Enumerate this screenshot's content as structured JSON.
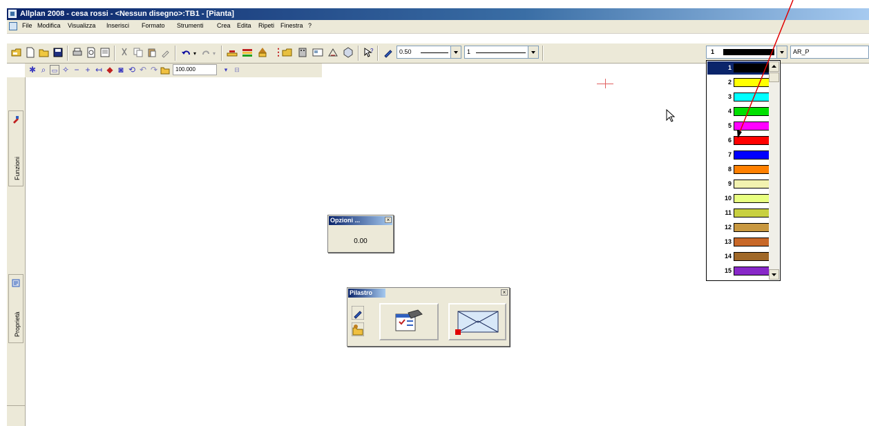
{
  "window": {
    "title": "Allplan 2008 - cesa rossi - <Nessun disegno>:TB1 - [Pianta]"
  },
  "menu": {
    "items": [
      "File",
      "Modifica",
      "Visualizza",
      "Inserisci",
      "Formato",
      "Strumenti",
      "Crea",
      "Edita",
      "Ripeti",
      "Finestra",
      "?"
    ]
  },
  "toolbar": {
    "pen_value": "0.50",
    "line_value": "1",
    "color_value": "1",
    "layer_value": "AR_P"
  },
  "toolbar2": {
    "scale_value": "100.000"
  },
  "sidebar": {
    "tabs": [
      "Funzioni",
      "Proprietà"
    ]
  },
  "color_dropdown": {
    "selected": "1",
    "items": [
      {
        "num": "1",
        "color": "#000000"
      },
      {
        "num": "2",
        "color": "#ffff00"
      },
      {
        "num": "3",
        "color": "#00ffff"
      },
      {
        "num": "4",
        "color": "#00e000"
      },
      {
        "num": "5",
        "color": "#ff00ff"
      },
      {
        "num": "6",
        "color": "#ff0000"
      },
      {
        "num": "7",
        "color": "#0000ff"
      },
      {
        "num": "8",
        "color": "#ff8000"
      },
      {
        "num": "9",
        "color": "#f2f2b0"
      },
      {
        "num": "10",
        "color": "#e8ff80"
      },
      {
        "num": "11",
        "color": "#c8d040"
      },
      {
        "num": "12",
        "color": "#c89840"
      },
      {
        "num": "13",
        "color": "#c86828"
      },
      {
        "num": "14",
        "color": "#a06828"
      },
      {
        "num": "15",
        "color": "#8828c8"
      }
    ]
  },
  "options_palette": {
    "title": "Opzioni ...",
    "value": "0.00"
  },
  "pilastro_palette": {
    "title": "Pilastro"
  },
  "colors": {
    "annotation_arrow": "#e00000",
    "title_bar": "#0a246a"
  }
}
